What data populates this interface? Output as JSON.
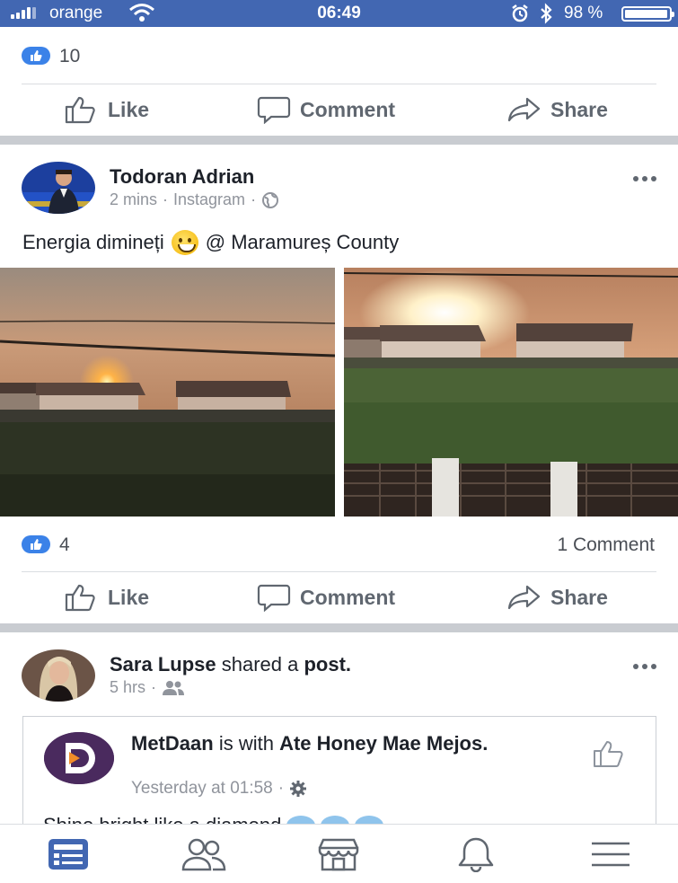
{
  "status_bar": {
    "carrier": "orange",
    "time": "06:49",
    "battery_percent": "98 %",
    "battery_level": 0.98
  },
  "top_post": {
    "like_count": "10",
    "actions": {
      "like": "Like",
      "comment": "Comment",
      "share": "Share"
    }
  },
  "post": {
    "author": "Todoran Adrian",
    "time": "2 mins",
    "source": "Instagram",
    "separator": "·",
    "text_before_emoji": "Energia dimineți",
    "text_after_emoji": "@ Maramureș County",
    "emoji": "grinning-face",
    "like_count": "4",
    "comment_count": "1 Comment",
    "actions": {
      "like": "Like",
      "comment": "Comment",
      "share": "Share"
    }
  },
  "shared_post": {
    "sharer_name": "Sara Lupse",
    "shared_label": "shared a",
    "shared_object": "post.",
    "time": "5 hrs",
    "separator": "·",
    "inner": {
      "page_name": "MetDaan",
      "with_label": "is with",
      "tagged": "Ate Honey Mae Mejos.",
      "time": "Yesterday at 01:58",
      "separator": "·",
      "snippet": "Shine bright like a diamond"
    }
  },
  "tab_bar": {
    "tabs": [
      "news-feed",
      "friends",
      "marketplace",
      "notifications",
      "menu"
    ],
    "active": "news-feed"
  },
  "colors": {
    "status_bar": "#4267b2",
    "like_blue": "#3b82e8",
    "active_tab": "#4267b2",
    "inactive_tab": "#606770",
    "feed_gap": "#c9ccd1"
  }
}
